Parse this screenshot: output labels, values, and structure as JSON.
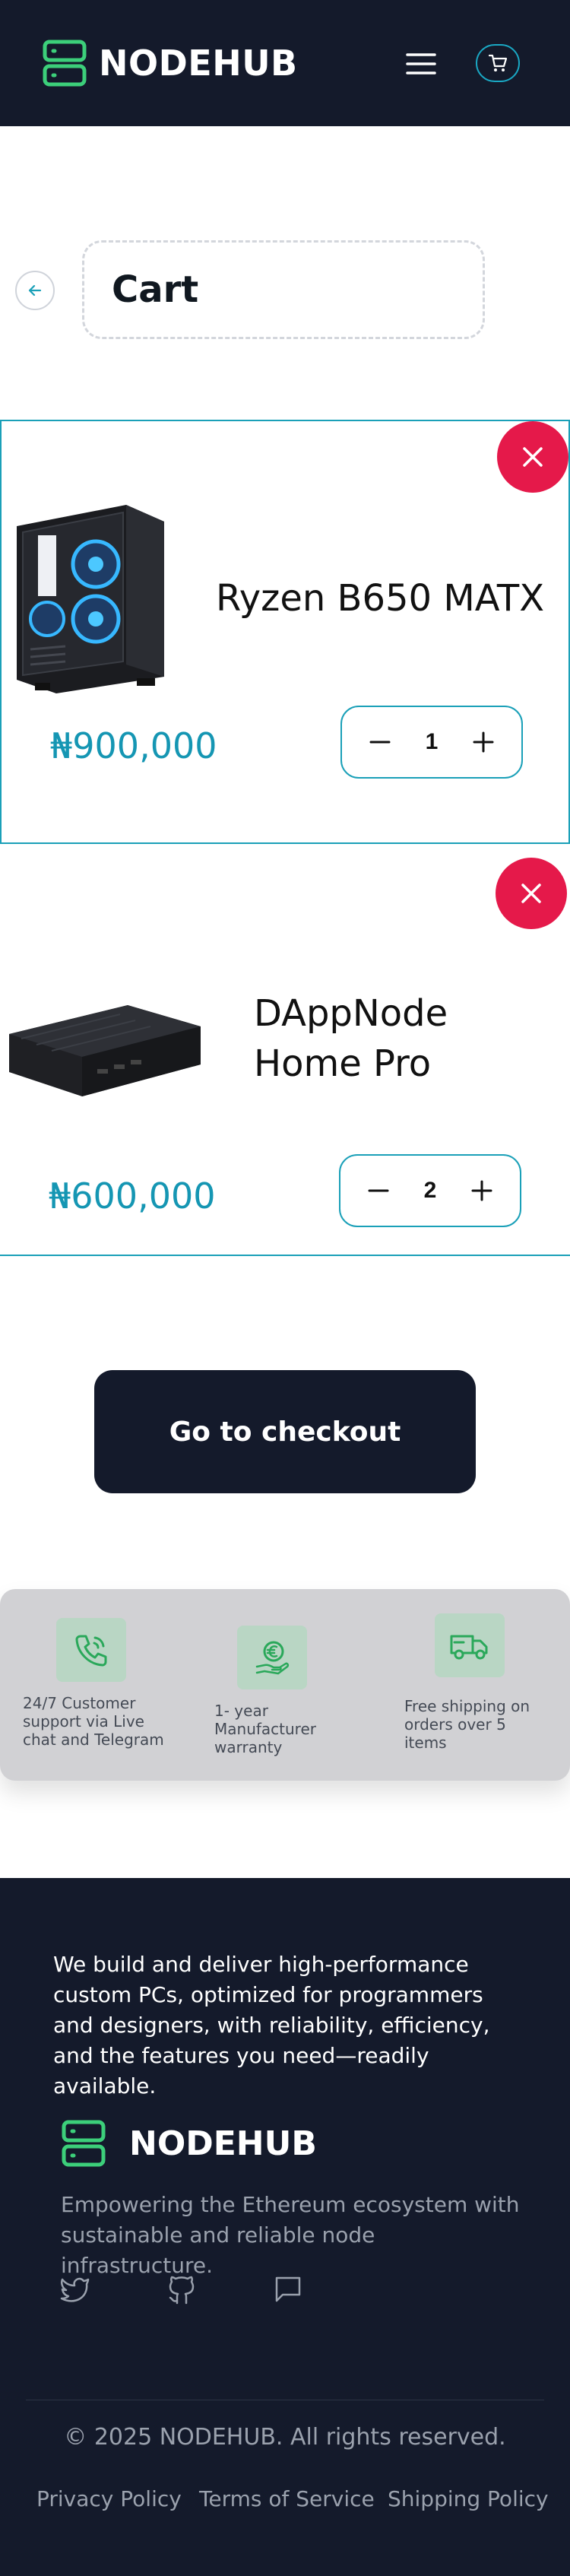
{
  "header": {
    "brand": "NODEHUB",
    "menu_icon": "hamburger-menu-icon",
    "cart_icon": "shopping-cart-icon"
  },
  "page": {
    "title": "Cart",
    "back_icon": "arrow-left-icon"
  },
  "cart": {
    "items": [
      {
        "name": "Ryzen B650 MATX",
        "price": "₦900,000",
        "quantity": "1",
        "image": "pc-tower-case"
      },
      {
        "name_line1": "DAppNode",
        "name_line2": "Home Pro",
        "price": "₦600,000",
        "quantity": "2",
        "image": "mini-pc-device"
      }
    ],
    "checkout_label": "Go to checkout"
  },
  "features": [
    {
      "icon": "phone-call-icon",
      "text_lines": [
        "24/7 Customer",
        "support via Live",
        "chat and Telegram"
      ]
    },
    {
      "icon": "euro-hand-icon",
      "text_lines": [
        "1- year",
        "Manufacturer",
        "warranty"
      ]
    },
    {
      "icon": "delivery-truck-icon",
      "text_lines": [
        "Free shipping on",
        "orders over 5",
        "items"
      ]
    }
  ],
  "footer": {
    "about": "We build and deliver high-performance custom PCs, optimized for programmers and designers, with reliability, efficiency, and the features you need—readily available.",
    "brand": "NODEHUB",
    "tagline": "Empowering the Ethereum ecosystem with sustainable and reliable node infrastructure.",
    "social_icons": [
      "twitter-icon",
      "github-icon",
      "message-icon"
    ],
    "copyright": "© 2025 NODEHUB. All rights reserved.",
    "links": [
      "Privacy Policy",
      "Terms of Service",
      "Shipping Policy"
    ]
  },
  "colors": {
    "navy": "#141a2b",
    "accent_teal": "#1aa0b8",
    "brand_green": "#3ccf7a",
    "remove_red": "#e5194a"
  }
}
